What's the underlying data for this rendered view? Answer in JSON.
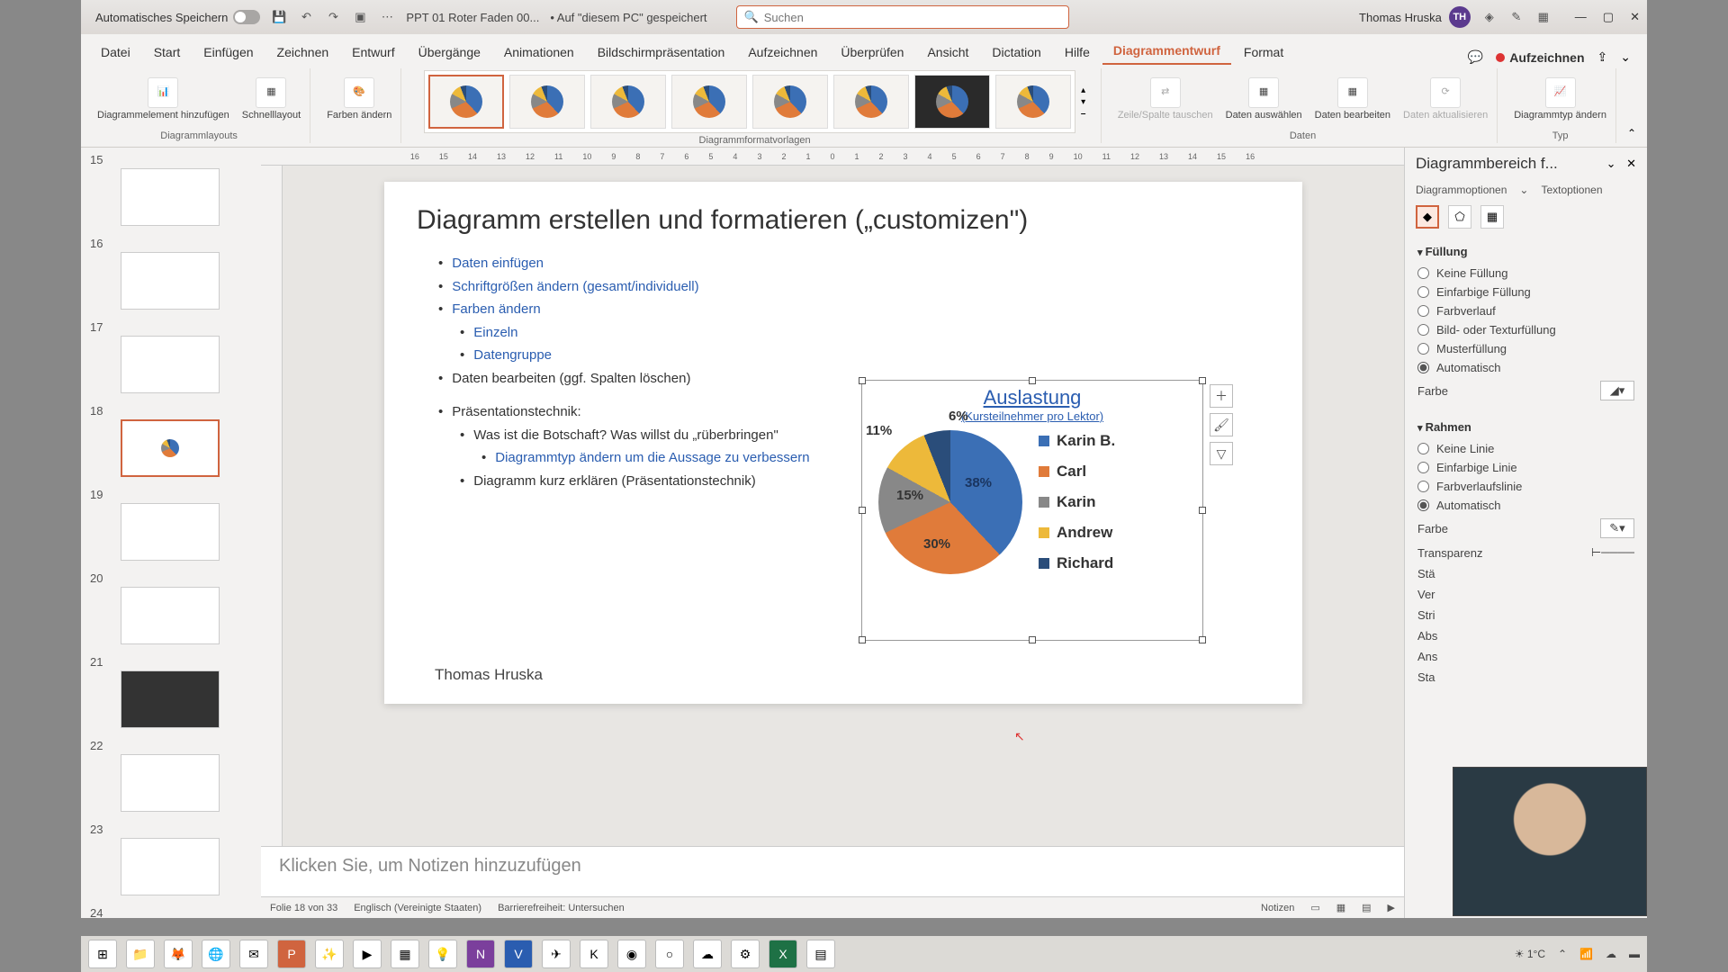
{
  "titlebar": {
    "autosave": "Automatisches Speichern",
    "filename": "PPT 01 Roter Faden 00...",
    "saved": "• Auf \"diesem PC\" gespeichert",
    "search_placeholder": "Suchen",
    "user": "Thomas Hruska",
    "initials": "TH"
  },
  "tabs": [
    "Datei",
    "Start",
    "Einfügen",
    "Zeichnen",
    "Entwurf",
    "Übergänge",
    "Animationen",
    "Bildschirmpräsentation",
    "Aufzeichnen",
    "Überprüfen",
    "Ansicht",
    "Dictation",
    "Hilfe",
    "Diagrammentwurf",
    "Format"
  ],
  "active_tab": "Diagrammentwurf",
  "record_label": "Aufzeichnen",
  "ribbon": {
    "layouts": {
      "add": "Diagrammelement hinzufügen",
      "quick": "Schnelllayout",
      "group": "Diagrammlayouts"
    },
    "colors": {
      "btn": "Farben ändern"
    },
    "styles_group": "Diagrammformatvorlagen",
    "data": {
      "swap": "Zeile/Spalte tauschen",
      "select": "Daten auswählen",
      "edit": "Daten bearbeiten",
      "refresh": "Daten aktualisieren",
      "group": "Daten"
    },
    "type": {
      "btn": "Diagrammtyp ändern",
      "group": "Typ"
    }
  },
  "thumbs": [
    15,
    16,
    17,
    18,
    19,
    20,
    21,
    22,
    23,
    24
  ],
  "selected_thumb": 18,
  "ruler": [
    "16",
    "15",
    "14",
    "13",
    "12",
    "11",
    "10",
    "9",
    "8",
    "7",
    "6",
    "5",
    "4",
    "3",
    "2",
    "1",
    "0",
    "1",
    "2",
    "3",
    "4",
    "5",
    "6",
    "7",
    "8",
    "9",
    "10",
    "11",
    "12",
    "13",
    "14",
    "15",
    "16"
  ],
  "slide": {
    "title": "Diagramm erstellen und formatieren („customizen\")",
    "b1": "Daten einfügen",
    "b2": "Schriftgrößen ändern (gesamt/individuell)",
    "b3": "Farben ändern",
    "b3a": "Einzeln",
    "b3b": "Datengruppe",
    "b4": "Daten bearbeiten (ggf. Spalten löschen)",
    "b5": "Präsentationstechnik:",
    "b5a": "Was ist die Botschaft? Was willst du „rüberbringen\"",
    "b5b": "Diagrammtyp ändern um die Aussage zu verbessern",
    "b5c": "Diagramm kurz erklären (Präsentationstechnik)",
    "footer": "Thomas Hruska"
  },
  "chart_data": {
    "type": "pie",
    "title": "Auslastung",
    "subtitle": "(Kursteilnehmer pro Lektor)",
    "series": [
      {
        "name": "Karin B.",
        "value": 38,
        "color": "#3b6fb5"
      },
      {
        "name": "Carl",
        "value": 30,
        "color": "#e07b3a"
      },
      {
        "name": "Karin",
        "value": 15,
        "color": "#888888"
      },
      {
        "name": "Andrew",
        "value": 11,
        "color": "#edb93a"
      },
      {
        "name": "Richard",
        "value": 6,
        "color": "#2a4d7a"
      }
    ]
  },
  "notes_placeholder": "Klicken Sie, um Notizen hinzuzufügen",
  "statusbar": {
    "slide": "Folie 18 von 33",
    "lang": "Englisch (Vereinigte Staaten)",
    "access": "Barrierefreiheit: Untersuchen",
    "notes": "Notizen"
  },
  "pane": {
    "title": "Diagrammbereich f...",
    "tab1": "Diagrammoptionen",
    "tab2": "Textoptionen",
    "fill": {
      "title": "Füllung",
      "none": "Keine Füllung",
      "solid": "Einfarbige Füllung",
      "grad": "Farbverlauf",
      "pic": "Bild- oder Texturfüllung",
      "pat": "Musterfüllung",
      "auto": "Automatisch",
      "color": "Farbe"
    },
    "border": {
      "title": "Rahmen",
      "none": "Keine Linie",
      "solid": "Einfarbige Linie",
      "grad": "Farbverlaufslinie",
      "auto": "Automatisch",
      "color": "Farbe",
      "trans": "Transparenz",
      "width": "Stä",
      "comp": "Ver",
      "dash": "Stri",
      "cap": "Abs",
      "join": "Ans",
      "sta": "Sta"
    }
  },
  "taskbar": {
    "temp": "1°C"
  }
}
